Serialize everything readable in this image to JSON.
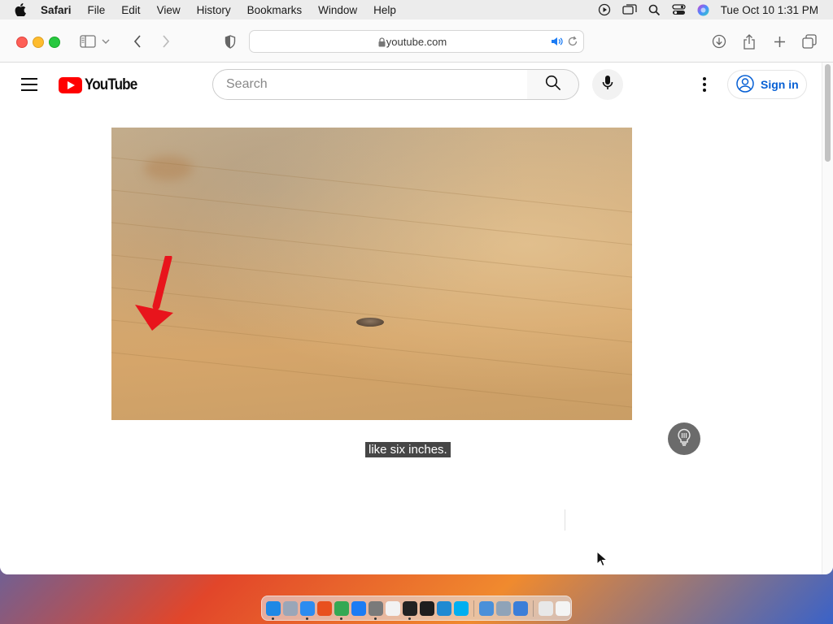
{
  "menubar": {
    "app_name": "Safari",
    "items": [
      "File",
      "Edit",
      "View",
      "History",
      "Bookmarks",
      "Window",
      "Help"
    ],
    "clock": "Tue Oct 10  1:31 PM"
  },
  "browser": {
    "url": "youtube.com"
  },
  "youtube": {
    "logo_text": "YouTube",
    "search_placeholder": "Search",
    "signin_label": "Sign in",
    "caption": "like six inches."
  },
  "dock": {
    "apps": [
      {
        "name": "finder",
        "color": "#1e88e5",
        "running": true
      },
      {
        "name": "launchpad",
        "color": "#9aa6b8",
        "running": false
      },
      {
        "name": "safari",
        "color": "#2d8cf0",
        "running": true
      },
      {
        "name": "firefox",
        "color": "#e8501e",
        "running": false
      },
      {
        "name": "chrome",
        "color": "#34a853",
        "running": true
      },
      {
        "name": "app-store",
        "color": "#1c7cf4",
        "running": false
      },
      {
        "name": "system-settings",
        "color": "#7a7a7a",
        "running": true
      },
      {
        "name": "textedit",
        "color": "#f2f2f2",
        "running": false
      },
      {
        "name": "terminal",
        "color": "#222222",
        "running": true
      },
      {
        "name": "figma",
        "color": "#1e1e1e",
        "running": false
      },
      {
        "name": "vscode",
        "color": "#1f8ad2",
        "running": false
      },
      {
        "name": "skype",
        "color": "#00aff0",
        "running": false
      },
      {
        "name": "sep",
        "color": "",
        "running": false
      },
      {
        "name": "preview",
        "color": "#4a90d9",
        "running": false
      },
      {
        "name": "image-capture",
        "color": "#8fa3b8",
        "running": false
      },
      {
        "name": "xcode",
        "color": "#3b7ed8",
        "running": false
      },
      {
        "name": "sep",
        "color": "",
        "running": false
      },
      {
        "name": "downloads-stack",
        "color": "#e8e8e8",
        "running": false
      },
      {
        "name": "trash",
        "color": "#f4f4f4",
        "running": false
      }
    ]
  }
}
